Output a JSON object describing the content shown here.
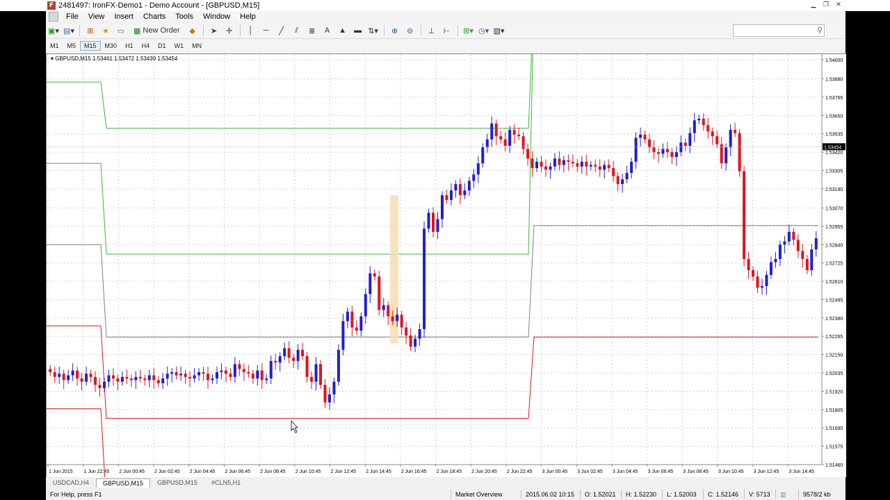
{
  "window": {
    "title": "2481497: IronFX-Demo1 - Demo Account - [GBPUSD,M15]"
  },
  "menu": [
    "File",
    "View",
    "Insert",
    "Charts",
    "Tools",
    "Window",
    "Help"
  ],
  "toolbar": {
    "new_order": "New Order",
    "search_placeholder": ""
  },
  "timeframes": {
    "items": [
      "M1",
      "M5",
      "M15",
      "M30",
      "H1",
      "H4",
      "D1",
      "W1",
      "MN"
    ],
    "active": "M15"
  },
  "chart": {
    "header": "GBPUSD,M15  1.53461 1.53472 1.53439 1.53454",
    "current_price": "1.53454",
    "colors": {
      "bull": "#1f1fd0",
      "bear": "#e0141e",
      "upper_band": "#3cb43c",
      "mid_band": "#808080",
      "lower_band": "#e0141e",
      "highlight": "#f5deb3"
    }
  },
  "chart_data": {
    "type": "candlestick",
    "symbol": "GBPUSD",
    "timeframe": "M15",
    "title": "GBPUSD,M15",
    "ohlc_last": {
      "open": 1.53461,
      "high": 1.53472,
      "low": 1.53439,
      "close": 1.53454
    },
    "ylim": [
      1.5146,
      1.54
    ],
    "y_ticks": [
      "1.54000",
      "1.53880",
      "1.53765",
      "1.53650",
      "1.53535",
      "1.53420",
      "1.53305",
      "1.53190",
      "1.53070",
      "1.52955",
      "1.52840",
      "1.52725",
      "1.52610",
      "1.52495",
      "1.52380",
      "1.52265",
      "1.52150",
      "1.52035",
      "1.51920",
      "1.51805",
      "1.51690",
      "1.51575",
      "1.51460"
    ],
    "x_ticks": [
      "1 Jun 2015",
      "1 Jun 22:45",
      "2 Jun 00:45",
      "2 Jun 02:45",
      "2 Jun 04:45",
      "2 Jun 06:45",
      "2 Jun 08:45",
      "2 Jun 10:45",
      "2 Jun 12:45",
      "2 Jun 14:45",
      "2 Jun 16:45",
      "2 Jun 18:45",
      "2 Jun 20:45",
      "2 Jun 22:45",
      "3 Jun 00:45",
      "3 Jun 02:45",
      "3 Jun 04:45",
      "3 Jun 06:45",
      "3 Jun 08:45",
      "3 Jun 10:45",
      "3 Jun 12:45",
      "3 Jun 14:45"
    ],
    "closes": [
      1.5204,
      1.5201,
      1.5203,
      1.5199,
      1.5202,
      1.5205,
      1.52,
      1.5198,
      1.5203,
      1.5201,
      1.5196,
      1.5194,
      1.5198,
      1.5202,
      1.52,
      1.5198,
      1.5201,
      1.52,
      1.5199,
      1.5201,
      1.52,
      1.5199,
      1.5202,
      1.5199,
      1.5197,
      1.52,
      1.5203,
      1.5204,
      1.5202,
      1.5203,
      1.5201,
      1.52,
      1.5202,
      1.5204,
      1.5203,
      1.5199,
      1.52,
      1.5204,
      1.5205,
      1.5203,
      1.5201,
      1.5209,
      1.5206,
      1.5204,
      1.5203,
      1.52,
      1.5205,
      1.5199,
      1.52,
      1.5211,
      1.521,
      1.5214,
      1.5219,
      1.5213,
      1.5211,
      1.5218,
      1.5214,
      1.5201,
      1.5198,
      1.5209,
      1.5196,
      1.5185,
      1.519,
      1.5198,
      1.5218,
      1.5236,
      1.5242,
      1.5232,
      1.523,
      1.5239,
      1.5253,
      1.5266,
      1.5264,
      1.5243,
      1.5246,
      1.5239,
      1.5236,
      1.524,
      1.5232,
      1.5227,
      1.522,
      1.5225,
      1.5231,
      1.5294,
      1.5304,
      1.5292,
      1.53,
      1.5315,
      1.5312,
      1.5318,
      1.5322,
      1.5315,
      1.5318,
      1.5324,
      1.5328,
      1.5335,
      1.5345,
      1.535,
      1.536,
      1.5352,
      1.535,
      1.5346,
      1.5356,
      1.5353,
      1.5352,
      1.5344,
      1.5338,
      1.5332,
      1.5336,
      1.5333,
      1.5331,
      1.5333,
      1.5338,
      1.5334,
      1.5337,
      1.5336,
      1.5335,
      1.5333,
      1.5336,
      1.5333,
      1.5334,
      1.5333,
      1.5331,
      1.5334,
      1.5332,
      1.5327,
      1.5322,
      1.5325,
      1.5329,
      1.5336,
      1.5351,
      1.5353,
      1.535,
      1.5345,
      1.5342,
      1.5341,
      1.5344,
      1.5342,
      1.5339,
      1.5342,
      1.5348,
      1.5346,
      1.5354,
      1.5362,
      1.5363,
      1.5359,
      1.5355,
      1.5352,
      1.5347,
      1.5335,
      1.5345,
      1.5356,
      1.5354,
      1.533,
      1.5275,
      1.5268,
      1.5264,
      1.5257,
      1.5258,
      1.5265,
      1.5273,
      1.5275,
      1.5284,
      1.5286,
      1.5292,
      1.5287,
      1.528,
      1.5275,
      1.5268,
      1.5281,
      1.5288
    ]
  },
  "tabs": {
    "items": [
      "USDCAD,H4",
      "GBPUSD,M15",
      "GBPUSD,M15",
      "#CLN5,H1"
    ],
    "active_index": 1
  },
  "status": {
    "help": "For Help, press F1",
    "profile": "Market Overview",
    "datetime": "2015.06.02 10:15",
    "open": "O: 1.52021",
    "high": "H: 1.52230",
    "low": "L: 1.52003",
    "close": "C: 1.52146",
    "volume": "V: 5713",
    "traffic": "9578/2 kb"
  }
}
